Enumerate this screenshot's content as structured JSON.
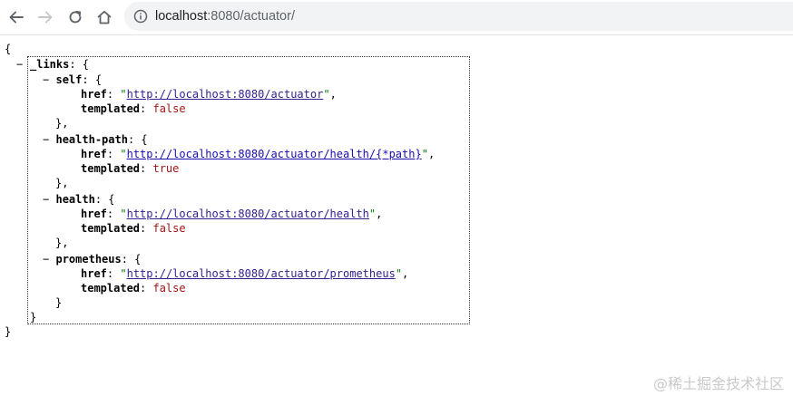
{
  "browser": {
    "url_host": "localhost",
    "url_rest": ":8080/actuator/",
    "icons": {
      "back": "back-arrow-icon",
      "forward": "forward-arrow-icon",
      "reload": "reload-icon",
      "home": "home-icon",
      "info": "info-icon"
    }
  },
  "json_view": {
    "open_brace": "{",
    "close_brace": "}",
    "collapse_toggle": "−",
    "links_key": "_links",
    "entries": [
      {
        "name": "self",
        "href": "http://localhost:8080/actuator",
        "templated": "false",
        "trailing": ","
      },
      {
        "name": "health-path",
        "href": "http://localhost:8080/actuator/health/{*path}",
        "templated": "true",
        "trailing": ","
      },
      {
        "name": "health",
        "href": "http://localhost:8080/actuator/health",
        "templated": "false",
        "trailing": ","
      },
      {
        "name": "prometheus",
        "href": "http://localhost:8080/actuator/prometheus",
        "templated": "false",
        "trailing": ""
      }
    ],
    "href_key": "href",
    "templated_key": "templated"
  },
  "watermark": "@稀土掘金技术社区",
  "colors": {
    "link": "#35208f",
    "bool": "#a31515",
    "string_quote": "#0b7a0b"
  }
}
